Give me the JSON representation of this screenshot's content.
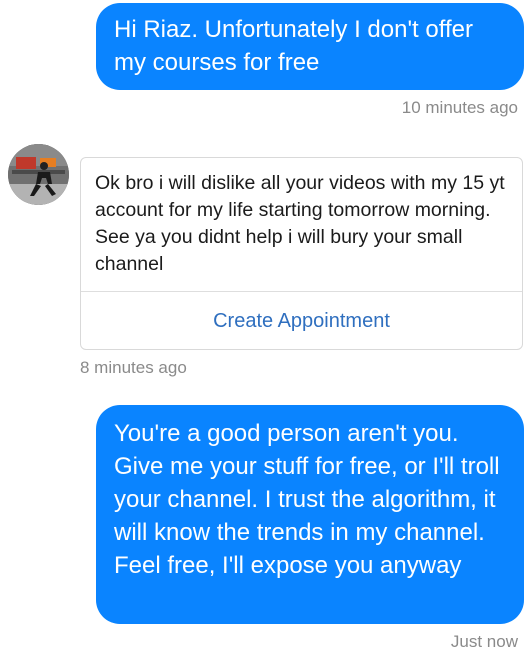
{
  "messages": {
    "outgoing_1": {
      "text": "Hi Riaz. Unfortunately I don't offer my courses for free",
      "time": "10 minutes ago"
    },
    "incoming": {
      "text": "Ok bro i will dislike all your videos with my 15 yt account for my life starting tomorrow morning. See ya you didnt help i will bury your small channel",
      "action_label": "Create Appointment",
      "time": "8 minutes ago"
    },
    "outgoing_2": {
      "text": "You're a good person aren't you. Give me your stuff for free, or I'll troll your channel. I trust the algorithm, it will know the trends in my channel. Feel free, I'll expose you anyway",
      "time": "Just now"
    }
  },
  "colors": {
    "outgoing_bubble": "#0a84ff",
    "link": "#2f6fbf",
    "timestamp": "#8a8a8a"
  }
}
